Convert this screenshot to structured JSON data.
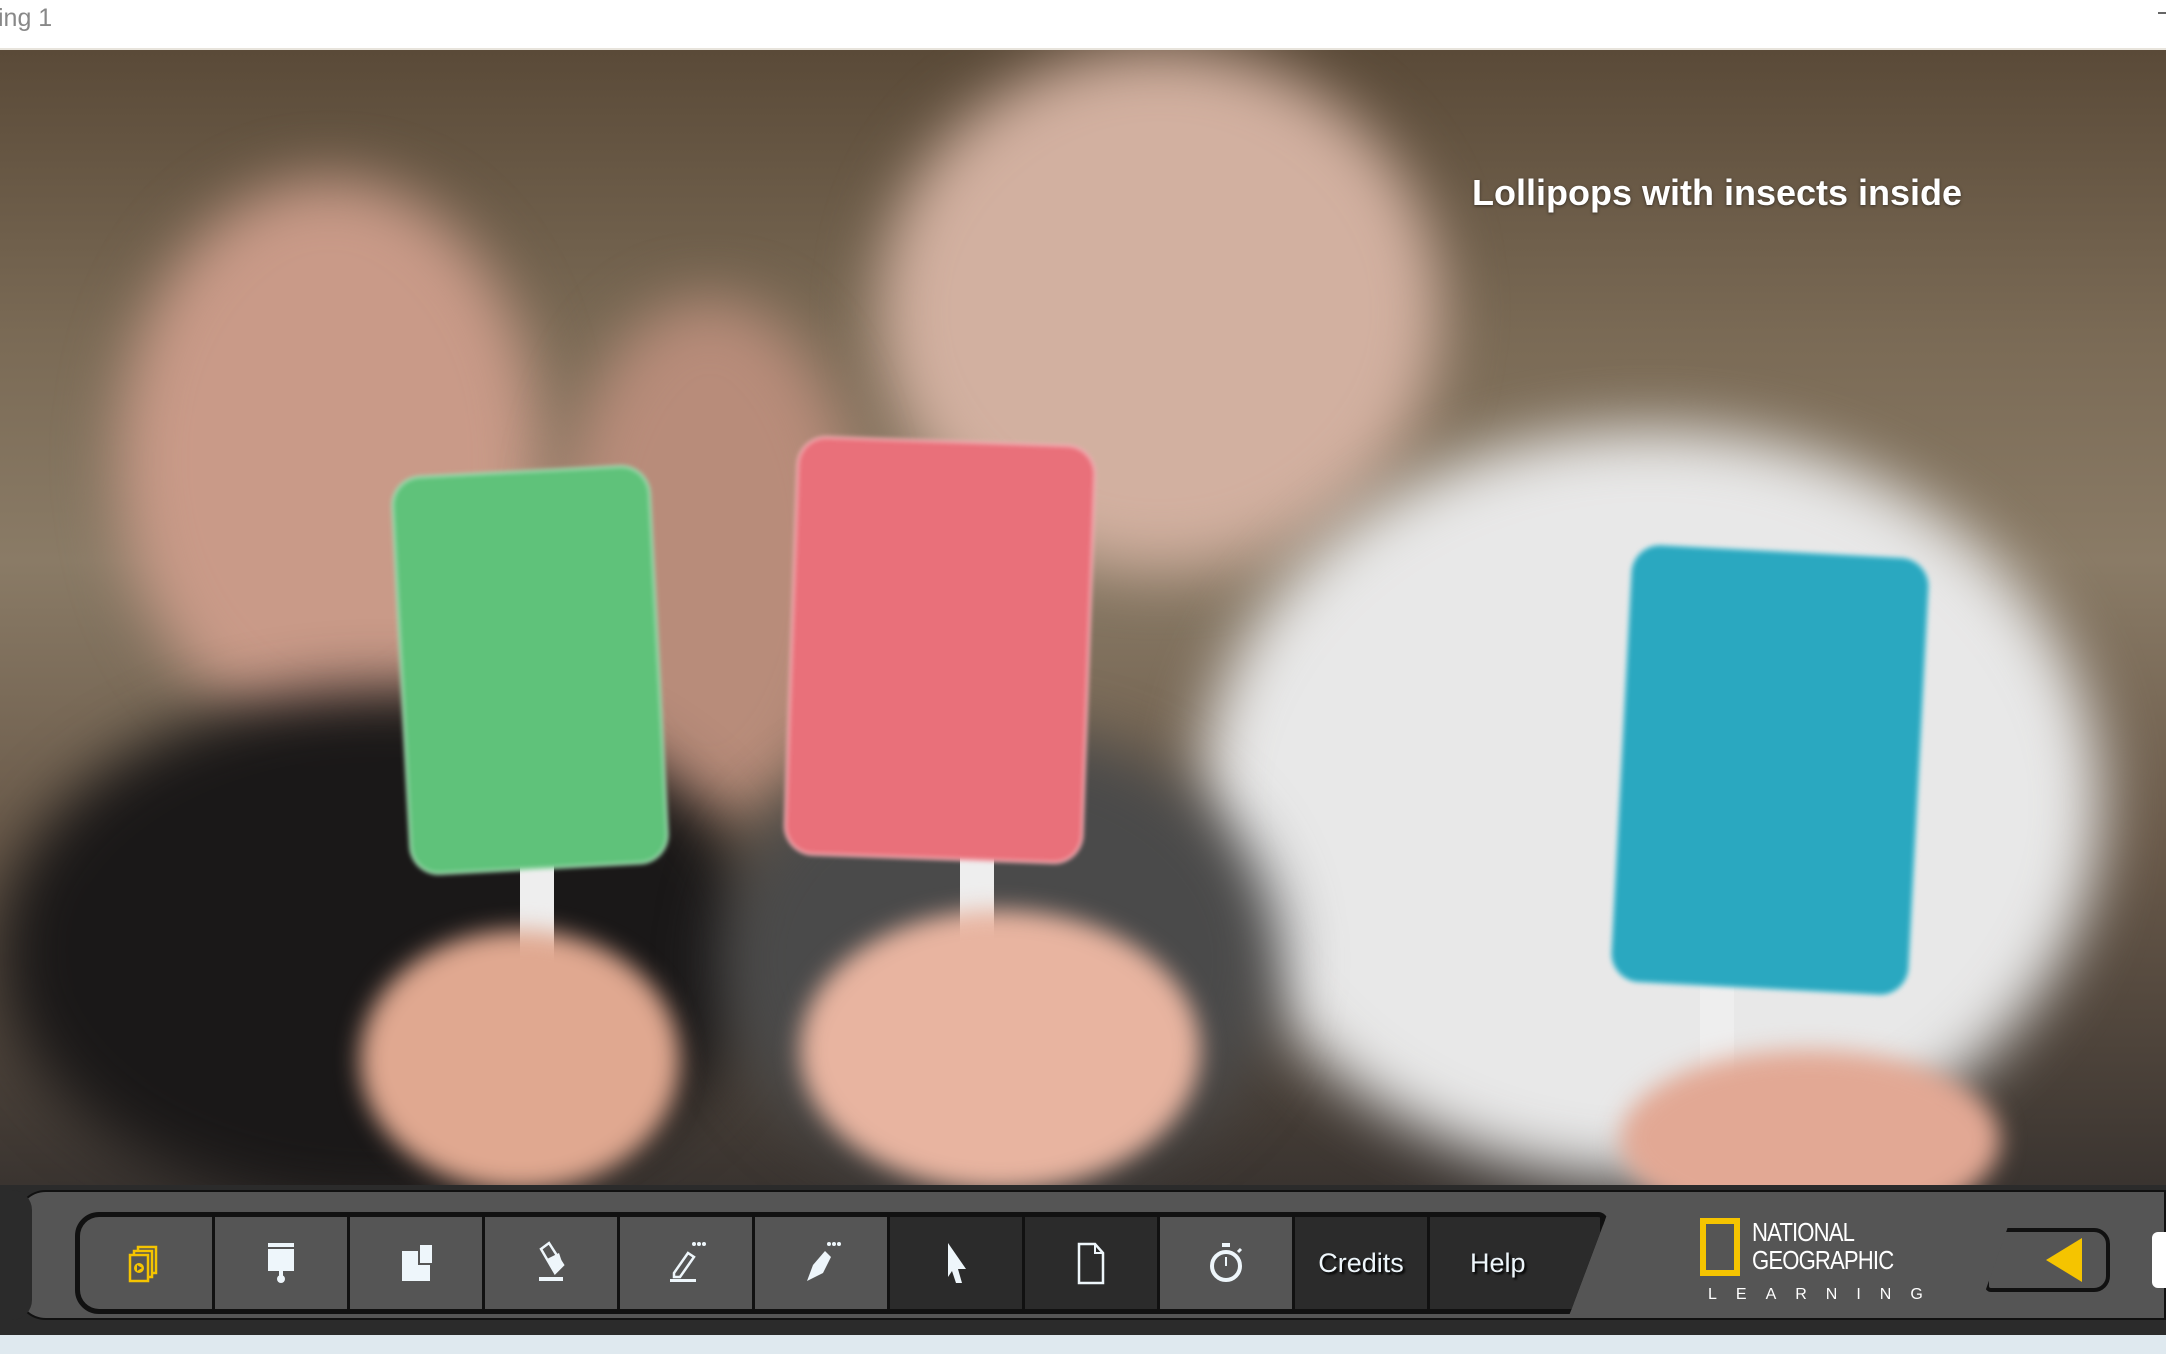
{
  "window": {
    "title": "ing 1"
  },
  "slide": {
    "caption": "Lollipops with insects inside",
    "image_description_alt": "Lollipops with insects inside"
  },
  "toolbar": {
    "buttons": [
      {
        "name": "media-gallery",
        "icon": "media-stack-icon",
        "color": "#f5c400"
      },
      {
        "name": "presentation-screen",
        "icon": "screen-shade-icon"
      },
      {
        "name": "spotlight",
        "icon": "reveal-blocks-icon"
      },
      {
        "name": "eraser",
        "icon": "eraser-icon"
      },
      {
        "name": "highlighter",
        "icon": "highlighter-icon"
      },
      {
        "name": "pen",
        "icon": "pen-nib-icon"
      },
      {
        "name": "pointer",
        "icon": "cursor-arrow-icon",
        "active": true
      },
      {
        "name": "blank-page",
        "icon": "page-icon",
        "active": true
      },
      {
        "name": "timer",
        "icon": "stopwatch-icon"
      }
    ],
    "credits_label": "Credits",
    "help_label": "Help"
  },
  "logo": {
    "line1": "NATIONAL",
    "line2": "GEOGRAPHIC",
    "line3": "LEARNING",
    "accent": "#f5c400"
  },
  "nav": {
    "back_icon": "triangle-left-icon",
    "accent": "#f5c400"
  }
}
